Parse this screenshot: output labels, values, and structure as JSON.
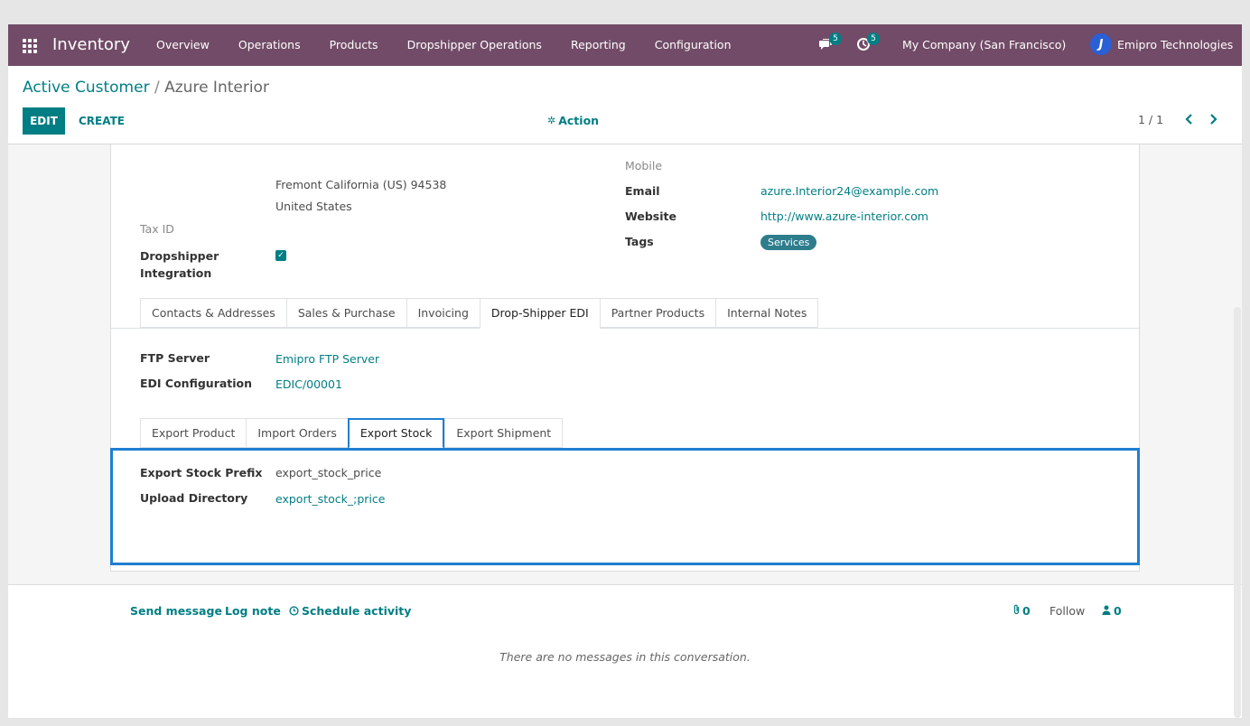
{
  "navbar": {
    "app_name": "Inventory",
    "menu": [
      "Overview",
      "Operations",
      "Products",
      "Dropshipper Operations",
      "Reporting",
      "Configuration"
    ],
    "messages_count": "5",
    "activities_count": "5",
    "company": "My Company (San Francisco)",
    "user": "Emipro Technologies"
  },
  "breadcrumb": {
    "parent": "Active Customer",
    "separator": "/",
    "current": "Azure Interior"
  },
  "toolbar": {
    "edit_label": "EDIT",
    "create_label": "CREATE",
    "action_label": "Action",
    "pager": "1 / 1"
  },
  "form": {
    "address_line": "Fremont  California (US)  94538",
    "country": "United States",
    "tax_id_label": "Tax ID",
    "dropshipper_label_1": "Dropshipper",
    "dropshipper_label_2": "Integration",
    "mobile_label": "Mobile",
    "email_label": "Email",
    "email_value": "azure.Interior24@example.com",
    "website_label": "Website",
    "website_value": "http://www.azure-interior.com",
    "tags_label": "Tags",
    "tag_value": "Services"
  },
  "tabs": [
    "Contacts & Addresses",
    "Sales & Purchase",
    "Invoicing",
    "Drop-Shipper EDI",
    "Partner Products",
    "Internal Notes"
  ],
  "edi": {
    "ftp_label": "FTP Server",
    "ftp_value": "Emipro FTP Server",
    "config_label": "EDI Configuration",
    "config_value": "EDIC/00001"
  },
  "subtabs": [
    "Export Product",
    "Import Orders",
    "Export Stock",
    "Export Shipment"
  ],
  "export_stock": {
    "prefix_label": "Export Stock Prefix",
    "prefix_value": "export_stock_price",
    "dir_label": "Upload Directory",
    "dir_value": "export_stock_;price"
  },
  "chatter": {
    "send_message": "Send message",
    "log_note": "Log note",
    "schedule_activity": "Schedule activity",
    "attachments_count": "0",
    "follow": "Follow",
    "followers_count": "0",
    "no_messages": "There are no messages in this conversation."
  },
  "colors": {
    "navbar": "#714b67",
    "primary": "#017e84",
    "highlight": "#1f7fd1"
  }
}
